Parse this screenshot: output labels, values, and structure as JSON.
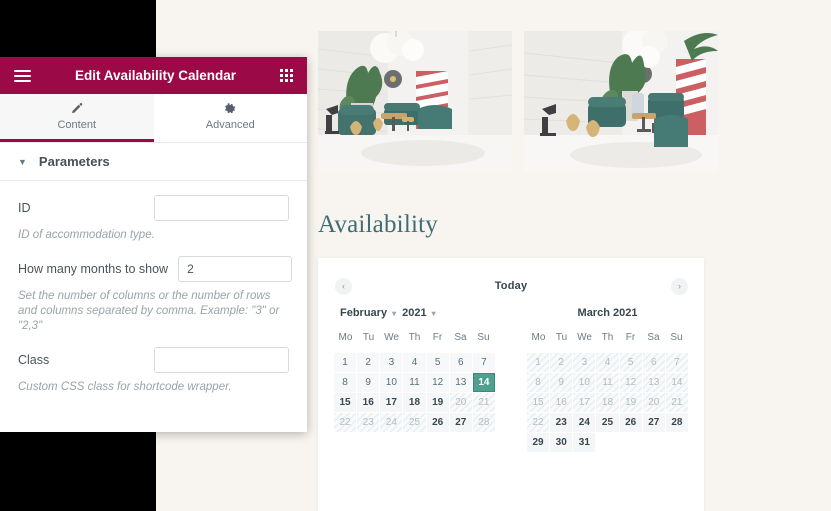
{
  "editor_panel": {
    "menu_icon": "hamburger-icon",
    "grid_icon": "apps-grid-icon",
    "title": "Edit Availability Calendar",
    "tabs": [
      {
        "label": "Content",
        "icon": "pencil-icon",
        "active": true
      },
      {
        "label": "Advanced",
        "icon": "gear-icon",
        "active": false
      }
    ],
    "section": {
      "title": "Parameters",
      "toggle_icon": "chevron-down-icon",
      "fields": [
        {
          "label": "ID",
          "value": "",
          "placeholder": "",
          "hint": "ID of accommodation type."
        },
        {
          "label": "How many months to show",
          "value": "2",
          "placeholder": "",
          "hint": "Set the number of columns or the number of rows and columns separated by comma. Example: \"3\" or \"2,3\""
        },
        {
          "label": "Class",
          "value": "",
          "placeholder": "",
          "hint": "Custom CSS class for shortcode wrapper."
        }
      ]
    }
  },
  "preview": {
    "gallery": [
      {
        "alt": "lounge-interior-photo-1"
      },
      {
        "alt": "lounge-interior-photo-2"
      }
    ],
    "section_title": "Availability",
    "calendar": {
      "prev_icon": "chevron-left-icon",
      "next_icon": "chevron-right-icon",
      "today_label": "Today",
      "weekdays": [
        "Mo",
        "Tu",
        "We",
        "Th",
        "Fr",
        "Sa",
        "Su"
      ],
      "highlight_color": "#4fa08f",
      "months": [
        {
          "name": "February",
          "year": "2021",
          "has_selects": true,
          "lead_blanks": 0,
          "days": [
            {
              "d": "1",
              "state": "past"
            },
            {
              "d": "2",
              "state": "past"
            },
            {
              "d": "3",
              "state": "past"
            },
            {
              "d": "4",
              "state": "past"
            },
            {
              "d": "5",
              "state": "past"
            },
            {
              "d": "6",
              "state": "past"
            },
            {
              "d": "7",
              "state": "past"
            },
            {
              "d": "8",
              "state": "past"
            },
            {
              "d": "9",
              "state": "past"
            },
            {
              "d": "10",
              "state": "past"
            },
            {
              "d": "11",
              "state": "past"
            },
            {
              "d": "12",
              "state": "past"
            },
            {
              "d": "13",
              "state": "past"
            },
            {
              "d": "14",
              "state": "today"
            },
            {
              "d": "15",
              "state": "avail"
            },
            {
              "d": "16",
              "state": "avail"
            },
            {
              "d": "17",
              "state": "avail"
            },
            {
              "d": "18",
              "state": "avail"
            },
            {
              "d": "19",
              "state": "avail"
            },
            {
              "d": "20",
              "state": "unavail"
            },
            {
              "d": "21",
              "state": "unavail"
            },
            {
              "d": "22",
              "state": "unavail"
            },
            {
              "d": "23",
              "state": "unavail"
            },
            {
              "d": "24",
              "state": "unavail"
            },
            {
              "d": "25",
              "state": "unavail"
            },
            {
              "d": "26",
              "state": "avail"
            },
            {
              "d": "27",
              "state": "avail"
            },
            {
              "d": "28",
              "state": "unavail"
            }
          ]
        },
        {
          "name": "March",
          "year": "2021",
          "has_selects": false,
          "lead_blanks": 0,
          "days": [
            {
              "d": "1",
              "state": "unavail"
            },
            {
              "d": "2",
              "state": "unavail"
            },
            {
              "d": "3",
              "state": "unavail"
            },
            {
              "d": "4",
              "state": "unavail"
            },
            {
              "d": "5",
              "state": "unavail"
            },
            {
              "d": "6",
              "state": "unavail"
            },
            {
              "d": "7",
              "state": "unavail"
            },
            {
              "d": "8",
              "state": "unavail"
            },
            {
              "d": "9",
              "state": "unavail"
            },
            {
              "d": "10",
              "state": "unavail"
            },
            {
              "d": "11",
              "state": "unavail"
            },
            {
              "d": "12",
              "state": "unavail"
            },
            {
              "d": "13",
              "state": "unavail"
            },
            {
              "d": "14",
              "state": "unavail"
            },
            {
              "d": "15",
              "state": "unavail"
            },
            {
              "d": "16",
              "state": "unavail"
            },
            {
              "d": "17",
              "state": "unavail"
            },
            {
              "d": "18",
              "state": "unavail"
            },
            {
              "d": "19",
              "state": "unavail"
            },
            {
              "d": "20",
              "state": "unavail"
            },
            {
              "d": "21",
              "state": "unavail"
            },
            {
              "d": "22",
              "state": "unavail"
            },
            {
              "d": "23",
              "state": "avail"
            },
            {
              "d": "24",
              "state": "avail"
            },
            {
              "d": "25",
              "state": "avail"
            },
            {
              "d": "26",
              "state": "avail"
            },
            {
              "d": "27",
              "state": "avail"
            },
            {
              "d": "28",
              "state": "avail"
            },
            {
              "d": "29",
              "state": "avail"
            },
            {
              "d": "30",
              "state": "avail"
            },
            {
              "d": "31",
              "state": "avail"
            }
          ]
        }
      ]
    }
  }
}
